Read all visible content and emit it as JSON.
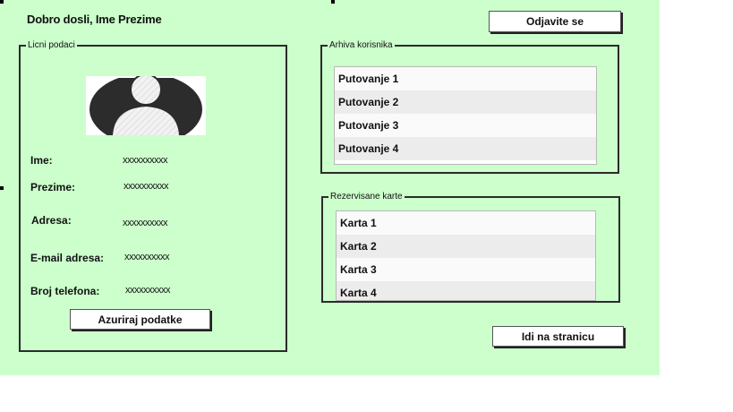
{
  "header": {
    "welcome_text": "Dobro dosli, Ime Prezime",
    "logout_label": "Odjavite se"
  },
  "profile": {
    "legend": "Licni podaci",
    "avatar_icon": "user-avatar-icon",
    "fields": [
      {
        "label": "Ime:",
        "value": "xxxxxxxxxx"
      },
      {
        "label": "Prezime:",
        "value": "xxxxxxxxxx"
      },
      {
        "label": "Adresa:",
        "value": "xxxxxxxxxx"
      },
      {
        "label": "E-mail adresa:",
        "value": "xxxxxxxxxx"
      },
      {
        "label": "Broj telefona:",
        "value": "xxxxxxxxxx"
      }
    ],
    "update_label": "Azuriraj podatke"
  },
  "archive": {
    "legend": "Arhiva korisnika",
    "items": [
      "Putovanje 1",
      "Putovanje 2",
      "Putovanje 3",
      "Putovanje 4"
    ]
  },
  "tickets": {
    "legend": "Rezervisane karte",
    "items": [
      "Karta 1",
      "Karta 2",
      "Karta 3",
      "Karta 4"
    ]
  },
  "goto_label": "Idi na stranicu",
  "colors": {
    "canvas_bg": "#ccffcc",
    "border": "#2b2b2b",
    "list_odd": "#fafafa",
    "list_even": "#ececec"
  }
}
